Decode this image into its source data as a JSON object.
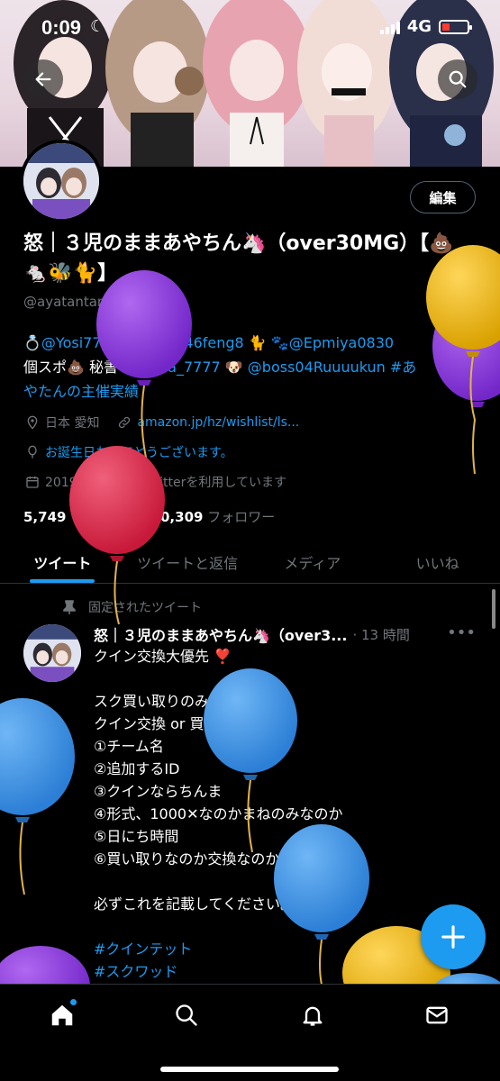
{
  "status": {
    "time": "0:09",
    "network": "4G"
  },
  "profile": {
    "name": "怒｜３児のままあやちん🦄（over30MG）【💩🐁🐝🐈】",
    "handle": "@ayatantankk",
    "edit_label": "編集",
    "bio_line1_parts": [
      "💍",
      "@Yosi77755",
      " 🦄",
      "@9646feng8",
      " 🐈",
      "🐾",
      "@Epmiya0830"
    ],
    "bio_line2_text": "個スポ💩 秘書 ",
    "bio_line2_link1": "@Fuma_7777",
    "bio_line2_mid": " 🐶 ",
    "bio_line2_link2": "@boss04Ruuuukun",
    "bio_line2_link3": " #あ",
    "bio_line3": "やたんの主催実績",
    "location": "日本 愛知",
    "website": "amazon.jp/hz/wishlist/ls...",
    "birthday": "お誕生日おめでとうございます。",
    "joined": "2019年10月からTwitterを利用しています",
    "following_count": "5,749",
    "following_label": "フォロー中",
    "followers_count": "10,309",
    "followers_label": "フォロワー"
  },
  "tabs": [
    "ツイート",
    "ツイートと返信",
    "メディア",
    "いいね"
  ],
  "tweet": {
    "pinned_label": "固定されたツイート",
    "author": "怒｜３児のままあやちん🦄（over3...",
    "time": "13 時間",
    "lines": [
      "クイン交換大優先 ❣️",
      "",
      "スク買い取りのみ",
      "クイン交換 or 買い取りのみ",
      "①チーム名",
      "②追加するID",
      "③クインならちんま",
      "④形式、1000✕なのかまねのみなのか",
      "⑤日にち時間",
      "⑥買い取りなのか交換なのか",
      "",
      "必ずこれを記載してください。",
      ""
    ],
    "hashtags": [
      "#クインテット",
      "#スクワッド"
    ]
  },
  "icons": {
    "back": "back-arrow-icon",
    "search": "search-icon",
    "home": "home-icon",
    "explore": "search-icon",
    "notifications": "bell-icon",
    "messages": "envelope-icon",
    "compose": "plus-icon"
  },
  "colors": {
    "accent": "#1d9bf0",
    "background": "#000000",
    "muted": "#71767b"
  }
}
